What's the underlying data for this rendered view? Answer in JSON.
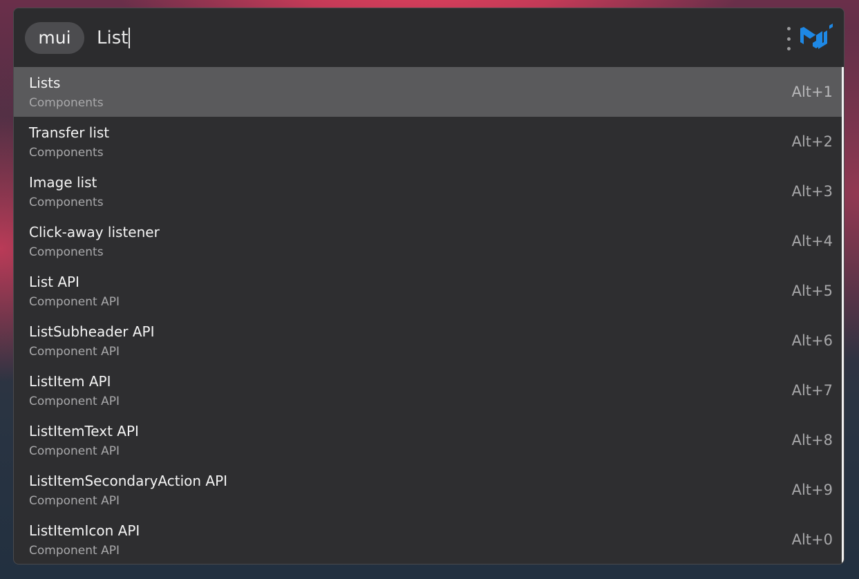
{
  "search": {
    "prefix": "mui",
    "query": "List"
  },
  "results": [
    {
      "title": "Lists",
      "category": "Components",
      "shortcut": "Alt+1",
      "selected": true
    },
    {
      "title": "Transfer list",
      "category": "Components",
      "shortcut": "Alt+2",
      "selected": false
    },
    {
      "title": "Image list",
      "category": "Components",
      "shortcut": "Alt+3",
      "selected": false
    },
    {
      "title": "Click-away listener",
      "category": "Components",
      "shortcut": "Alt+4",
      "selected": false
    },
    {
      "title": "List API",
      "category": "Component API",
      "shortcut": "Alt+5",
      "selected": false
    },
    {
      "title": "ListSubheader API",
      "category": "Component API",
      "shortcut": "Alt+6",
      "selected": false
    },
    {
      "title": "ListItem API",
      "category": "Component API",
      "shortcut": "Alt+7",
      "selected": false
    },
    {
      "title": "ListItemText API",
      "category": "Component API",
      "shortcut": "Alt+8",
      "selected": false
    },
    {
      "title": "ListItemSecondaryAction API",
      "category": "Component API",
      "shortcut": "Alt+9",
      "selected": false
    },
    {
      "title": "ListItemIcon API",
      "category": "Component API",
      "shortcut": "Alt+0",
      "selected": false
    }
  ],
  "icons": {
    "more": "more-vertical-icon",
    "logo": "mui-logo-icon"
  },
  "colors": {
    "panel": "#2e2e30",
    "selected_row": "#5a5a5c",
    "logo_blue": "#1e88e5",
    "pill": "#4c4c4f"
  }
}
